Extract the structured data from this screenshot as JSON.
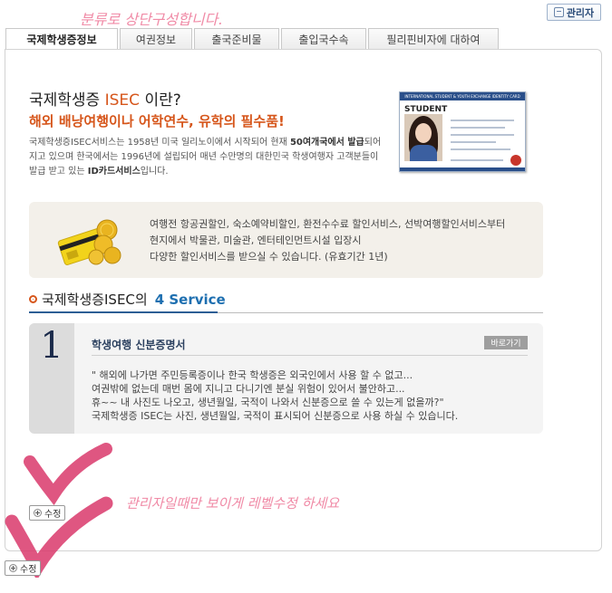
{
  "annotations": {
    "top": "분류로 상단구성합니다.",
    "bottom": "관리자일때만 보이게 레벨수정 하세요"
  },
  "header": {
    "admin_label": "관리자"
  },
  "tabs": [
    {
      "label": "국제학생증정보",
      "active": true
    },
    {
      "label": "여권정보",
      "active": false
    },
    {
      "label": "출국준비물",
      "active": false
    },
    {
      "label": "출입국수속",
      "active": false
    },
    {
      "label": "필리핀비자에 대하여",
      "active": false
    }
  ],
  "intro": {
    "title_prefix": "국제학생증",
    "title_accent": "ISEC",
    "title_suffix": "이란?",
    "subtitle": "해외 배낭여행이나 어학연수, 유학의 필수품!",
    "desc_1": "국제학생증ISEC서비스는 1958년 미국 일리노이에서 시작되어 현재",
    "desc_bold_1": "50여개국에서 발급",
    "desc_2": "되어 지고 있으며 한국에서는 1996년에 설립되어 매년 수만명의 대한민국 학생여행자 고객분들이 발급 받고 있는",
    "desc_bold_2": "ID카드서비스",
    "desc_3": "입니다."
  },
  "card": {
    "header": "INTERNATIONAL STUDENT & YOUTH EXCHANGE IDENTITY CARD",
    "label": "STUDENT"
  },
  "benefits": {
    "line1": "여행전 항공권할인, 숙소예약비할인, 환전수수료 할인서비스, 선박여행할인서비스부터",
    "line2": "현지에서 박물관, 미술관, 엔터테인먼트시설 입장시",
    "line3": "다양한 할인서비스를 받으실 수 있습니다. (유효기간 1년)"
  },
  "section": {
    "title": "국제학생증ISEC의",
    "accent": "4 Service"
  },
  "service": {
    "number": "1",
    "title": "학생여행 신분증명서",
    "go_label": "바로가기",
    "body": "\" 해외에 나가면 주민등록증이나 한국 학생증은 외국인에서 사용 할 수 없고...\n여권밖에 없는데 매번 몸에 지니고 다니기엔 분실 위험이 있어서 불안하고...\n휴~~ 내 사진도 나오고, 생년월일, 국적이 나와서 신분증으로 쓸 수 있는게 없을까?\"\n국제학생증 ISEC는 사진, 생년월일, 국적이 표시되어 신분증으로 사용 하실 수 있습니다."
  },
  "buttons": {
    "edit_label": "수정",
    "edit2_label": "수정"
  }
}
